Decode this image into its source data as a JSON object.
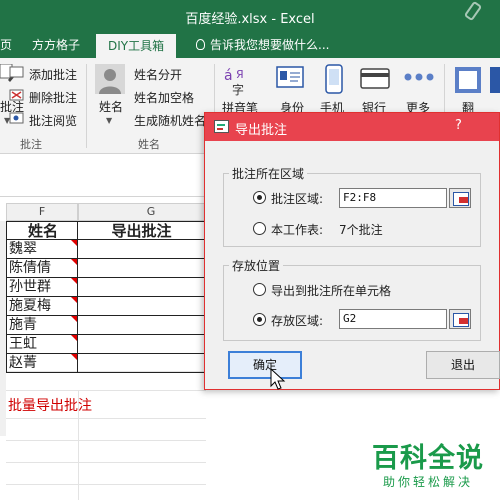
{
  "window": {
    "title": "百度经验.xlsx - Excel"
  },
  "tabs": {
    "tab1": "页",
    "tab2": "方方格子",
    "active": "DIY工具箱",
    "tellme": "告诉我您想要做什么..."
  },
  "ribbon": {
    "annot_left": "批注",
    "add_comment": "添加批注",
    "delete_comment": "删除批注",
    "browse_comment": "批注阅览",
    "group_comment": "批注",
    "name_button": "姓名",
    "split_name": "姓名分开",
    "add_space": "姓名加空格",
    "random_name": "生成随机姓名",
    "group_name": "姓名",
    "pinyin": "拼音笔",
    "id_card": "身份",
    "phone": "手机",
    "bank": "银行",
    "more": "更多",
    "translate": "翻"
  },
  "sheet": {
    "col_f": "F",
    "col_g": "G",
    "header_name": "姓名",
    "header_export": "导出批注",
    "names": [
      "魏翠",
      "陈倩倩",
      "孙世群",
      "施夏梅",
      "施青",
      "王虹",
      "赵菁"
    ],
    "note": "批量导出批注"
  },
  "dialog": {
    "title": "导出批注",
    "help": "?",
    "section_area": "批注所在区域",
    "opt_comment_area": "批注区域:",
    "comment_area_value": "F2:F8",
    "opt_worksheet": "本工作表:",
    "worksheet_count": "7个批注",
    "section_store": "存放位置",
    "opt_export_to_cell": "导出到批注所在单元格",
    "opt_store_area": "存放区域:",
    "store_area_value": "G2",
    "ok": "确定",
    "exit": "退出"
  },
  "watermark": {
    "big": "百科全说",
    "small": "助你轻松解决"
  },
  "colors": {
    "excel_green": "#217346",
    "dialog_red": "#e8434e",
    "comment_red": "#e00000",
    "watermark_green": "#1a9a4a"
  }
}
